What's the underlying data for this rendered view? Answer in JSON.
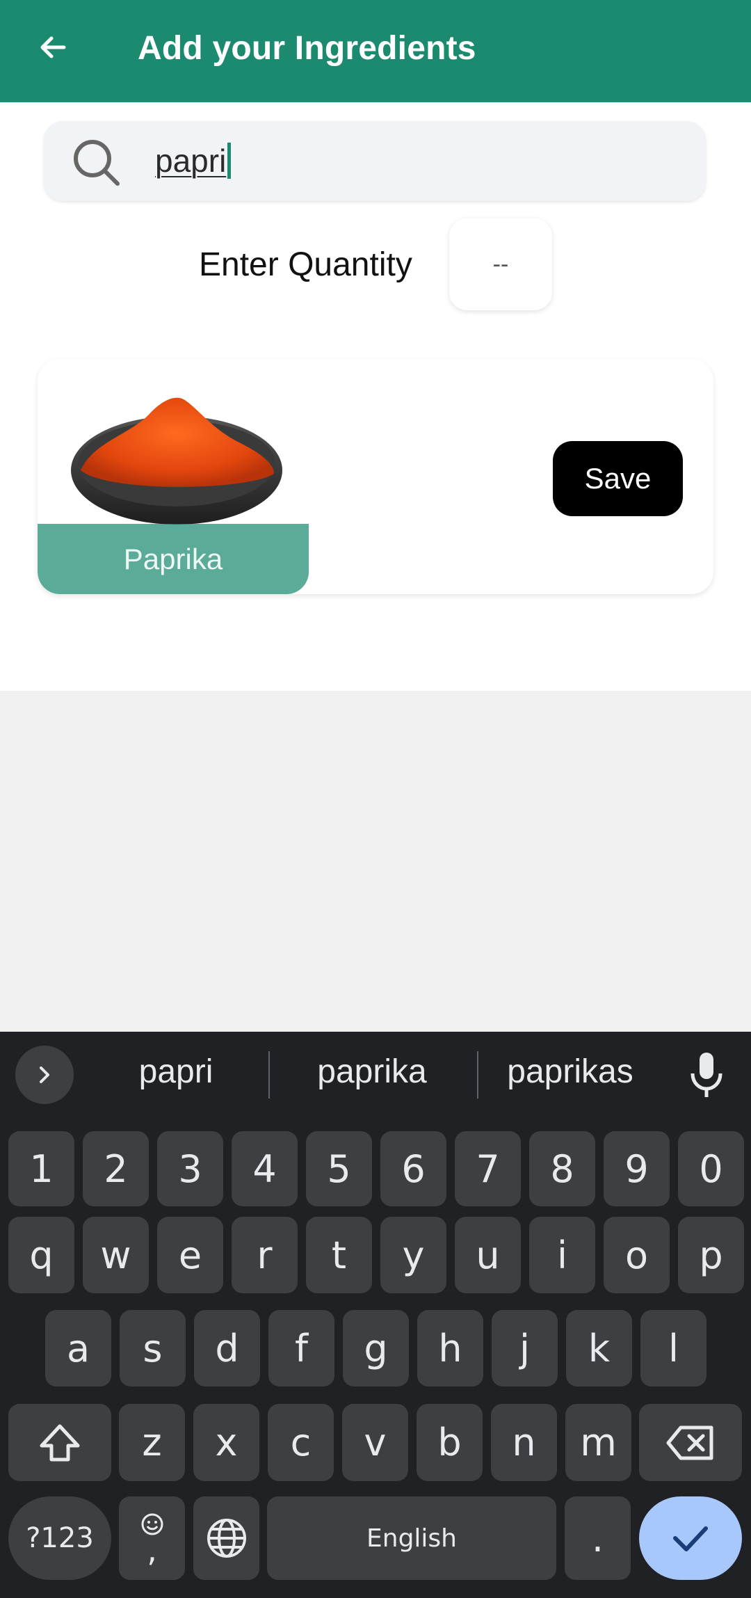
{
  "appbar": {
    "title": "Add your Ingredients",
    "back_icon": "arrow-left-icon"
  },
  "search": {
    "value": "papri",
    "icon": "search-icon"
  },
  "quantity": {
    "label": "Enter Quantity",
    "value": "--"
  },
  "result": {
    "name": "Paprika",
    "save_label": "Save",
    "image": "paprika-bowl-image"
  },
  "keyboard": {
    "suggestions": [
      "papri",
      "paprika",
      "paprikas"
    ],
    "digits": [
      "1",
      "2",
      "3",
      "4",
      "5",
      "6",
      "7",
      "8",
      "9",
      "0"
    ],
    "row1": [
      "q",
      "w",
      "e",
      "r",
      "t",
      "y",
      "u",
      "i",
      "o",
      "p"
    ],
    "row2": [
      "a",
      "s",
      "d",
      "f",
      "g",
      "h",
      "j",
      "k",
      "l"
    ],
    "row3": [
      "z",
      "x",
      "c",
      "v",
      "b",
      "n",
      "m"
    ],
    "symbols_label": "?123",
    "emoji_comma": ",",
    "space_label": "English",
    "period_label": ".",
    "colors": {
      "background": "#202124",
      "key": "#3c4043",
      "enter": "#a8c7fa"
    }
  },
  "colors": {
    "accent": "#1b8a6f"
  }
}
